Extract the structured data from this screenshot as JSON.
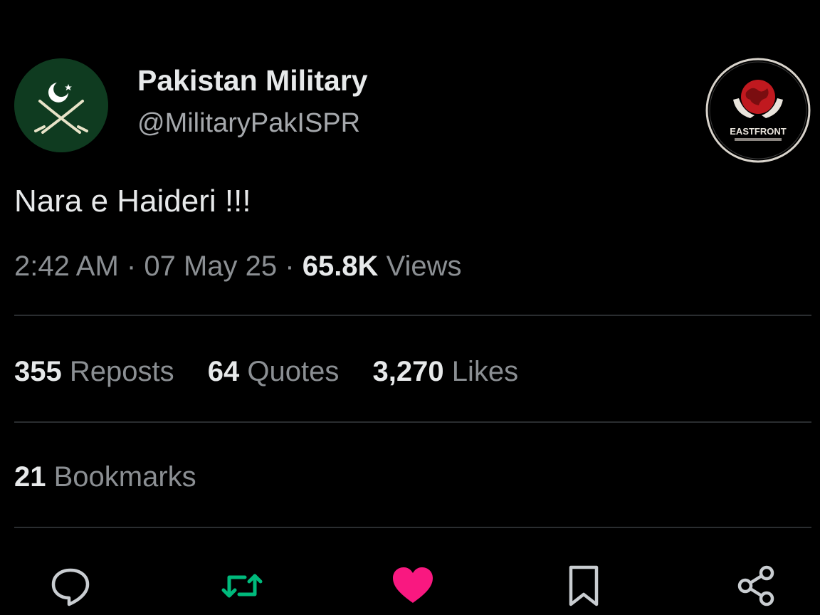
{
  "user": {
    "display_name": "Pakistan Military",
    "handle": "@MilitaryPakISPR",
    "avatar_icon": "crescent-swords-emblem-icon",
    "avatar_bg": "#0f3b20"
  },
  "watermark": {
    "icon": "eastfront-logo-icon",
    "text": "EASTFRONT"
  },
  "tweet": {
    "text": "Nara e Haideri !!!"
  },
  "meta": {
    "time": "2:42 AM",
    "separator": "·",
    "date": "07 May 25",
    "views_count": "65.8K",
    "views_label": "Views"
  },
  "stats": {
    "reposts_count": "355",
    "reposts_label": "Reposts",
    "quotes_count": "64",
    "quotes_label": "Quotes",
    "likes_count": "3,270",
    "likes_label": "Likes",
    "bookmarks_count": "21",
    "bookmarks_label": "Bookmarks"
  },
  "actions": {
    "reply_icon": "reply-bubble-icon",
    "repost_icon": "repost-arrows-icon",
    "like_icon": "heart-icon",
    "bookmark_icon": "bookmark-icon",
    "share_icon": "share-nodes-icon",
    "repost_color": "#00ba7c",
    "like_color": "#f91880"
  }
}
